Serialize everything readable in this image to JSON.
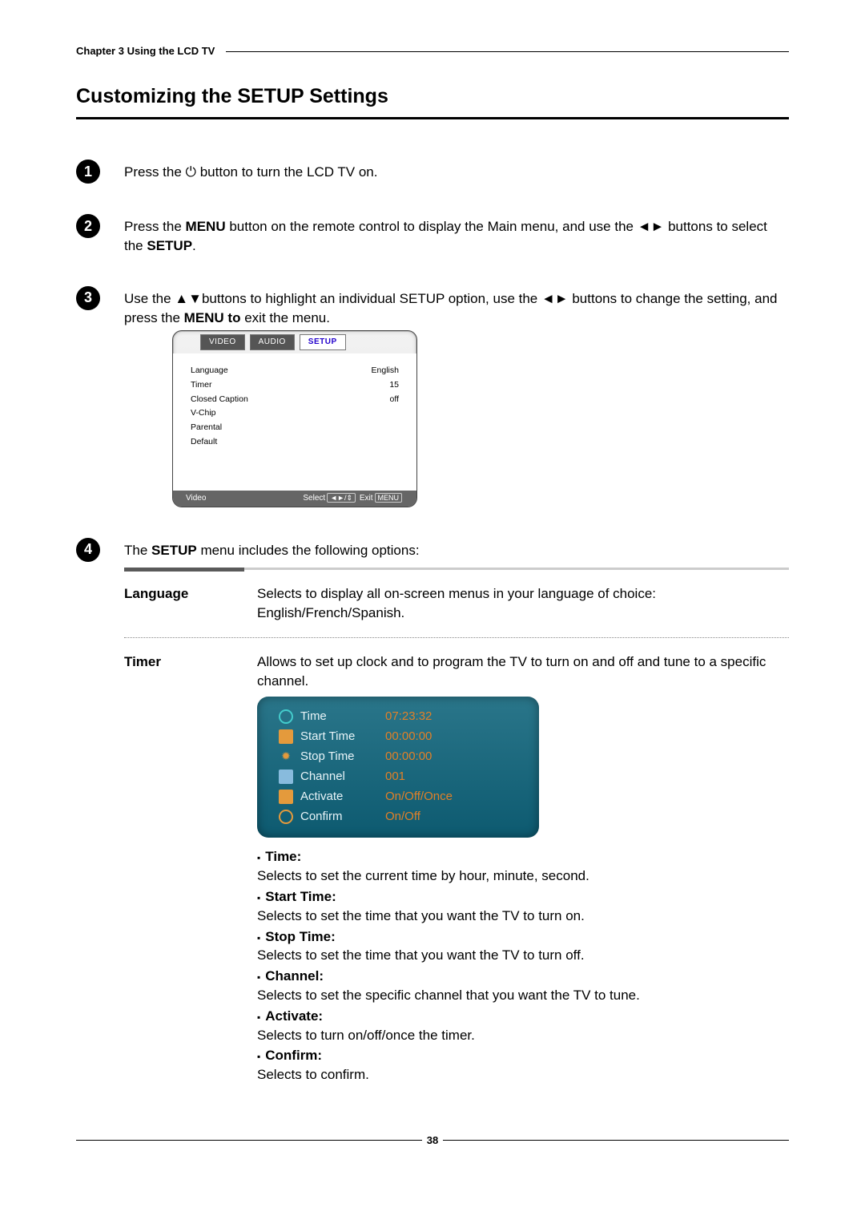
{
  "header": {
    "chapter": "Chapter 3 Using the LCD TV"
  },
  "title": "Customizing the SETUP Settings",
  "steps": {
    "s1": {
      "num": "1",
      "pre": "Press the ",
      "post": " button to turn the LCD TV on."
    },
    "s2": {
      "num": "2",
      "pre": "Press the ",
      "menu": "MENU",
      "mid": " button on the remote control to display the Main menu, and use the ◄► buttons to select the ",
      "b2": "SETUP",
      "post": "."
    },
    "s3": {
      "num": "3",
      "pre": "Use the  ▲▼buttons to highlight an individual SETUP option, use the ◄► buttons to change the setting, and press the ",
      "b": "MENU to",
      "post": " exit the menu."
    },
    "s4": {
      "num": "4",
      "pre": "The ",
      "b": "SETUP",
      "post": " menu includes the following options:"
    }
  },
  "osd": {
    "tabs": {
      "video": "VIDEO",
      "audio": "AUDIO",
      "setup": "SETUP"
    },
    "rows": [
      {
        "k": "Language",
        "v": "English"
      },
      {
        "k": "Timer",
        "v": "15"
      },
      {
        "k": "Closed Caption",
        "v": "off"
      },
      {
        "k": "V-Chip",
        "v": ""
      },
      {
        "k": "Parental",
        "v": ""
      },
      {
        "k": "Default",
        "v": ""
      }
    ],
    "footer": {
      "left": "Video",
      "select": "Select",
      "exit": "Exit",
      "menu": "MENU"
    }
  },
  "options": {
    "language": {
      "label": "Language",
      "desc": "Selects to display all on-screen menus in your language of choice: English/French/Spanish."
    },
    "timer": {
      "label": "Timer",
      "desc": "Allows to set up clock and to program the TV to turn on and off and tune to a specific channel.",
      "osd": [
        {
          "k": "Time",
          "v": "07:23:32"
        },
        {
          "k": "Start Time",
          "v": "00:00:00"
        },
        {
          "k": "Stop Time",
          "v": "00:00:00"
        },
        {
          "k": "Channel",
          "v": "001"
        },
        {
          "k": "Activate",
          "v": "On/Off/Once"
        },
        {
          "k": "Confirm",
          "v": "On/Off"
        }
      ],
      "bullets": [
        {
          "t": "Time:",
          "d": "Selects to set the current time by hour, minute, second."
        },
        {
          "t": "Start Time:",
          "d": "Selects to set the time that you want the TV to turn on."
        },
        {
          "t": "Stop Time:",
          "d": "Selects to set the time that you want the TV to turn off."
        },
        {
          "t": "Channel:",
          "d": "Selects to set the specific channel that you want the TV to tune."
        },
        {
          "t": "Activate:",
          "d": "Selects to turn on/off/once the timer."
        },
        {
          "t": "Confirm:",
          "d": "Selects to confirm."
        }
      ]
    }
  },
  "pageNumber": "38"
}
